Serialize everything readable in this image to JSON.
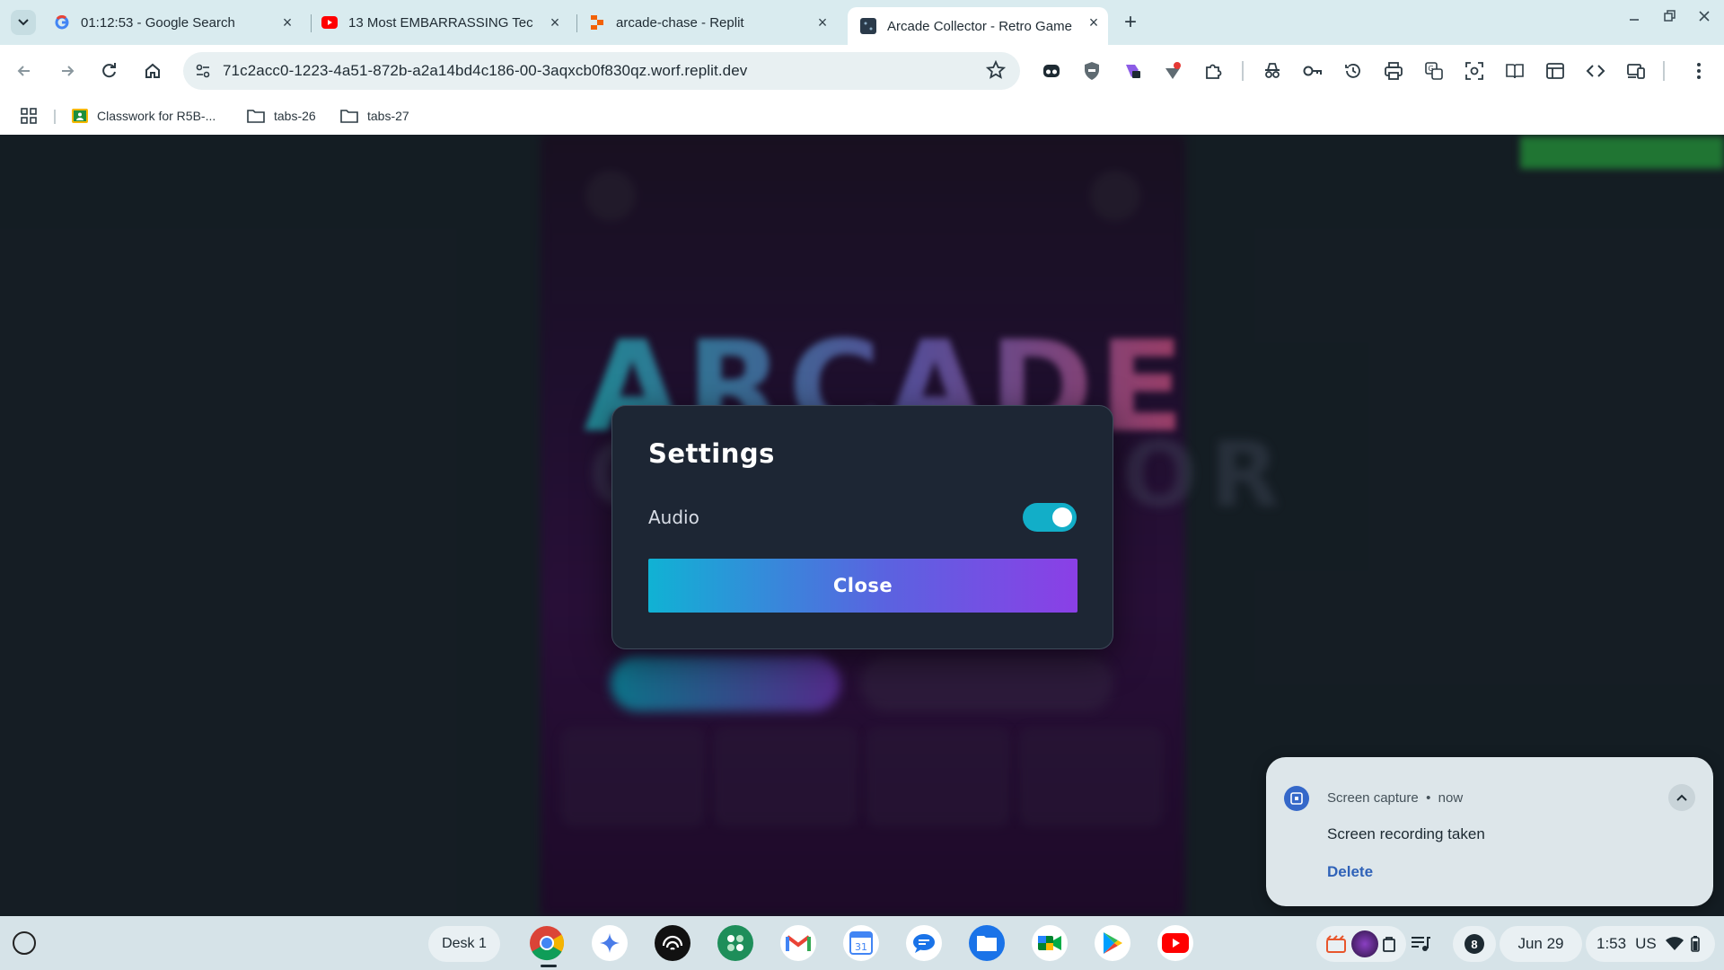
{
  "browser": {
    "tabs": [
      {
        "title": "01:12:53 - Google Search",
        "favicon": "google-icon",
        "active": false
      },
      {
        "title": "13 Most EMBARRASSING Tech",
        "favicon": "youtube-icon",
        "active": false
      },
      {
        "title": "arcade-chase - Replit",
        "favicon": "replit-icon",
        "active": false
      },
      {
        "title": "Arcade Collector - Retro Game",
        "favicon": "game-icon",
        "active": true
      }
    ],
    "url": "71c2acc0-1223-4a51-872b-a2a14bd4c186-00-3aqxcb0f830qz.worf.replit.dev",
    "bookmarks": [
      {
        "label": "Classwork for R5B-...",
        "icon": "classroom-icon"
      },
      {
        "label": "tabs-26",
        "icon": "folder-icon"
      },
      {
        "label": "tabs-27",
        "icon": "folder-icon"
      }
    ]
  },
  "settings_modal": {
    "title": "Settings",
    "audio_label": "Audio",
    "audio_enabled": true,
    "close_label": "Close",
    "accent": "#12aec8"
  },
  "background_game": {
    "title_line1": "ARCADE",
    "title_line2": "COLLECTOR"
  },
  "notification": {
    "source": "Screen capture",
    "time": "now",
    "message": "Screen recording taken",
    "action": "Delete"
  },
  "shelf": {
    "desk_label": "Desk 1",
    "notification_count": "8",
    "date": "Jun 29",
    "time": "1:53",
    "ime": "US"
  }
}
